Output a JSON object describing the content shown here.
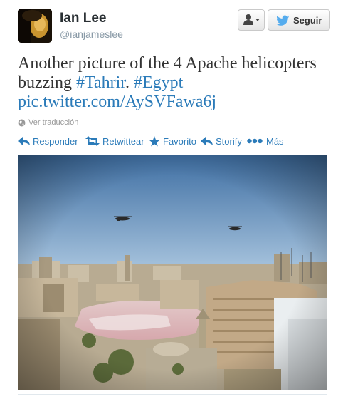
{
  "user": {
    "name": "Ian Lee",
    "handle": "@ianjameslee"
  },
  "buttons": {
    "follow_label": "Seguir"
  },
  "tweet": {
    "text_before": "Another picture of the 4 Apache helicopters buzzing ",
    "hashtag_1": "#Tahrir",
    "text_between": ". ",
    "hashtag_2": "#Egypt",
    "link": "pic.twitter.com/AySVFawa6j"
  },
  "translate_label": "Ver traducción",
  "actions": {
    "reply": "Responder",
    "retweet": "Retwittear",
    "favorite": "Favorito",
    "storify": "Storify",
    "more": "Más"
  },
  "icons": {
    "avatar": "avatar-photo",
    "user_dropdown": "user-icon",
    "follow": "bird-icon",
    "translate": "globe-icon",
    "reply": "reply-icon",
    "retweet": "retweet-icon",
    "favorite": "star-icon",
    "storify": "storify-icon",
    "more": "ellipsis-icon"
  },
  "colors": {
    "link": "#2b7bb9",
    "text": "#333333",
    "muted": "#8899a6"
  }
}
